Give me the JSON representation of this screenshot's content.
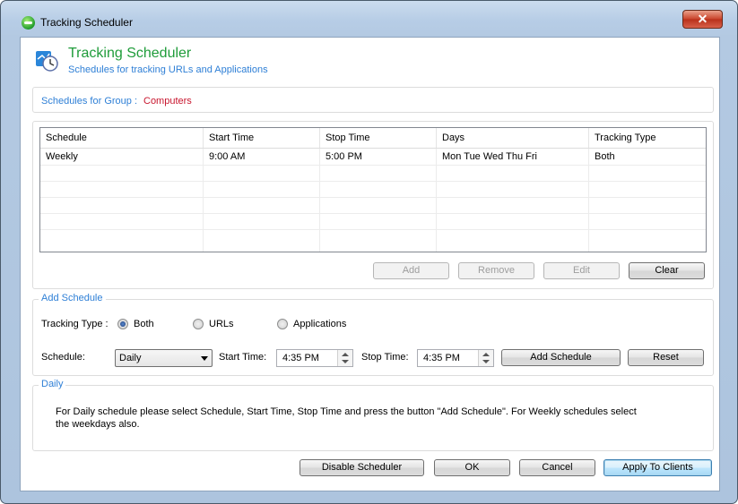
{
  "window": {
    "title": "Tracking Scheduler",
    "close_symbol": "✕"
  },
  "header": {
    "title": "Tracking Scheduler",
    "subtitle": "Schedules for tracking URLs and Applications"
  },
  "group": {
    "label": "Schedules for Group :",
    "value": "Computers"
  },
  "table": {
    "columns": [
      "Schedule",
      "Start Time",
      "Stop Time",
      "Days",
      "Tracking Type"
    ],
    "rows": [
      [
        "Weekly",
        "9:00 AM",
        "5:00 PM",
        "Mon Tue Wed Thu Fri",
        "Both"
      ]
    ]
  },
  "table_buttons": {
    "add": "Add",
    "remove": "Remove",
    "edit": "Edit",
    "clear": "Clear"
  },
  "add_schedule": {
    "legend": "Add Schedule",
    "tracking_type_label": "Tracking Type :",
    "options": [
      "Both",
      "URLs",
      "Applications"
    ],
    "selected_option": "Both",
    "schedule_label": "Schedule:",
    "schedule_value": "Daily",
    "start_label": "Start Time:",
    "start_value": "4:35 PM",
    "stop_label": "Stop Time:",
    "stop_value": "4:35 PM",
    "add_button": "Add Schedule",
    "reset_button": "Reset"
  },
  "daily": {
    "legend": "Daily",
    "info": "For Daily schedule please select Schedule, Start Time, Stop Time and press the button \"Add Schedule\". For Weekly schedules select the weekdays also."
  },
  "footer": {
    "disable": "Disable Scheduler",
    "ok": "OK",
    "cancel": "Cancel",
    "apply": "Apply To Clients"
  }
}
